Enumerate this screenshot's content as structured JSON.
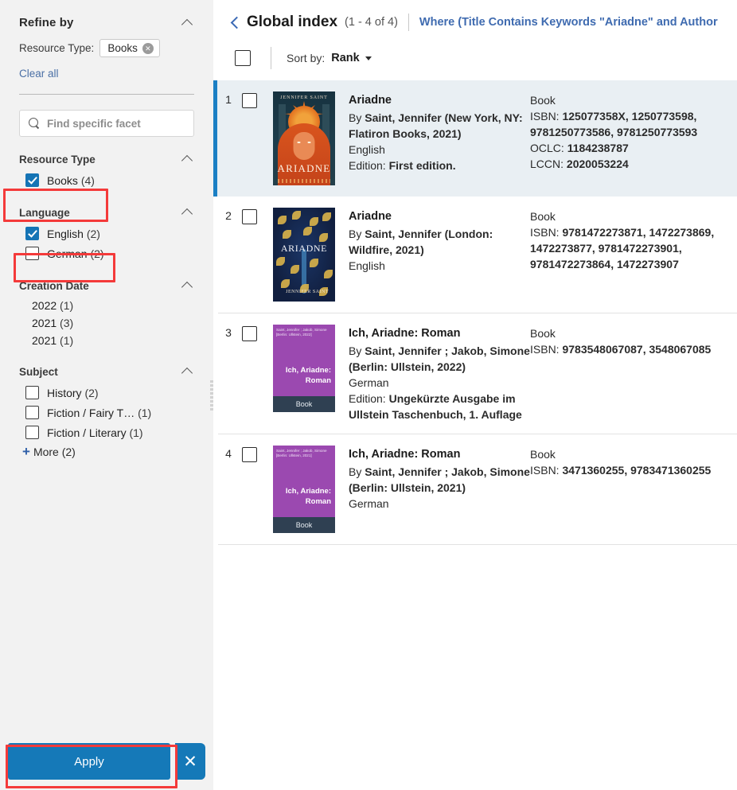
{
  "sidebar": {
    "refine_title": "Refine by",
    "collapse_icon": "chevron-up-icon",
    "resource_type_label": "Resource Type:",
    "active_chip": "Books",
    "chip_remove_icon": "remove-circle-icon",
    "clear_all": "Clear all",
    "facet_search_placeholder": "Find specific facet",
    "search_icon": "search-icon",
    "groups": [
      {
        "title": "Resource Type",
        "items": [
          {
            "label": "Books",
            "count": "(4)",
            "checked": true
          }
        ]
      },
      {
        "title": "Language",
        "items": [
          {
            "label": "English",
            "count": "(2)",
            "checked": true
          },
          {
            "label": "German",
            "count": "(2)",
            "checked": false
          }
        ]
      },
      {
        "title": "Creation Date",
        "dates": [
          {
            "label": "2022",
            "count": "(1)"
          },
          {
            "label": "2021",
            "count": "(3)"
          },
          {
            "label": "2021",
            "count": "(1)"
          }
        ]
      },
      {
        "title": "Subject",
        "items": [
          {
            "label": "History",
            "count": "(2)",
            "checked": false
          },
          {
            "label": "Fiction / Fairy T…",
            "count": "(1)",
            "checked": false
          },
          {
            "label": "Fiction / Literary",
            "count": "(1)",
            "checked": false
          }
        ],
        "more": "More (2)"
      }
    ],
    "apply_label": "Apply",
    "close_icon": "close-icon",
    "accent_color": "#1579b8",
    "annotation_color": "#f43a3a"
  },
  "main": {
    "back_icon": "back-chevron-icon",
    "title": "Global index",
    "count": "(1 - 4 of 4)",
    "query": "Where (Title Contains Keywords \"Ariadne\" and Author",
    "select_all_name": "select-all-checkbox",
    "sort_label": "Sort by:",
    "sort_value": "Rank",
    "sort_caret_icon": "chevron-down-icon",
    "results": [
      {
        "num": "1",
        "selected": true,
        "cover": "ariadne-flatiron",
        "cover_author": "JENNIFER SAINT",
        "cover_title": "ARIADNE",
        "title": "Ariadne",
        "by_prefix": "By ",
        "by": "Saint, Jennifer (New York, NY: Flatiron Books, 2021)",
        "language": "English",
        "edition_label": "Edition: ",
        "edition": "First edition.",
        "type": "Book",
        "ids": [
          {
            "label": "ISBN: ",
            "value": "125077358X, 1250773598, 9781250773586, 9781250773593"
          },
          {
            "label": "OCLC: ",
            "value": "1184238787"
          },
          {
            "label": "LCCN: ",
            "value": "2020053224"
          }
        ]
      },
      {
        "num": "2",
        "selected": false,
        "cover": "ariadne-wildfire",
        "cover_author": "JENNIFER SAINT",
        "cover_title": "ARIADNE",
        "title": "Ariadne",
        "by_prefix": "By ",
        "by": "Saint, Jennifer (London: Wildfire, 2021)",
        "language": "English",
        "edition_label": "",
        "edition": "",
        "type": "Book",
        "ids": [
          {
            "label": "ISBN: ",
            "value": "9781472273871, 1472273869, 1472273877, 9781472273901, 9781472273864, 1472273907"
          }
        ]
      },
      {
        "num": "3",
        "selected": false,
        "cover": "placeholder-purple",
        "cover_meta": "Saint, Jennifer ; Jakob, Simone [Berlin: Ullstein, 2022]",
        "cover_title": "Ich, Ariadne: Roman",
        "cover_type": "Book",
        "title": "Ich, Ariadne: Roman",
        "by_prefix": "By ",
        "by": "Saint, Jennifer ; Jakob, Simone (Berlin: Ullstein, 2022)",
        "language": "German",
        "edition_label": "Edition: ",
        "edition": "Ungekürzte Ausgabe im Ullstein Taschenbuch, 1. Auflage",
        "type": "Book",
        "ids": [
          {
            "label": "ISBN: ",
            "value": "9783548067087, 3548067085"
          }
        ]
      },
      {
        "num": "4",
        "selected": false,
        "cover": "placeholder-purple",
        "cover_meta": "Saint, Jennifer ; Jakob, Simone [Berlin: Ullstein, 2021]",
        "cover_title": "Ich, Ariadne: Roman",
        "cover_type": "Book",
        "title": "Ich, Ariadne: Roman",
        "by_prefix": "By ",
        "by": "Saint, Jennifer ; Jakob, Simone (Berlin: Ullstein, 2021)",
        "language": "German",
        "edition_label": "",
        "edition": "",
        "type": "Book",
        "ids": [
          {
            "label": "ISBN: ",
            "value": "3471360255, 9783471360255"
          }
        ]
      }
    ]
  }
}
